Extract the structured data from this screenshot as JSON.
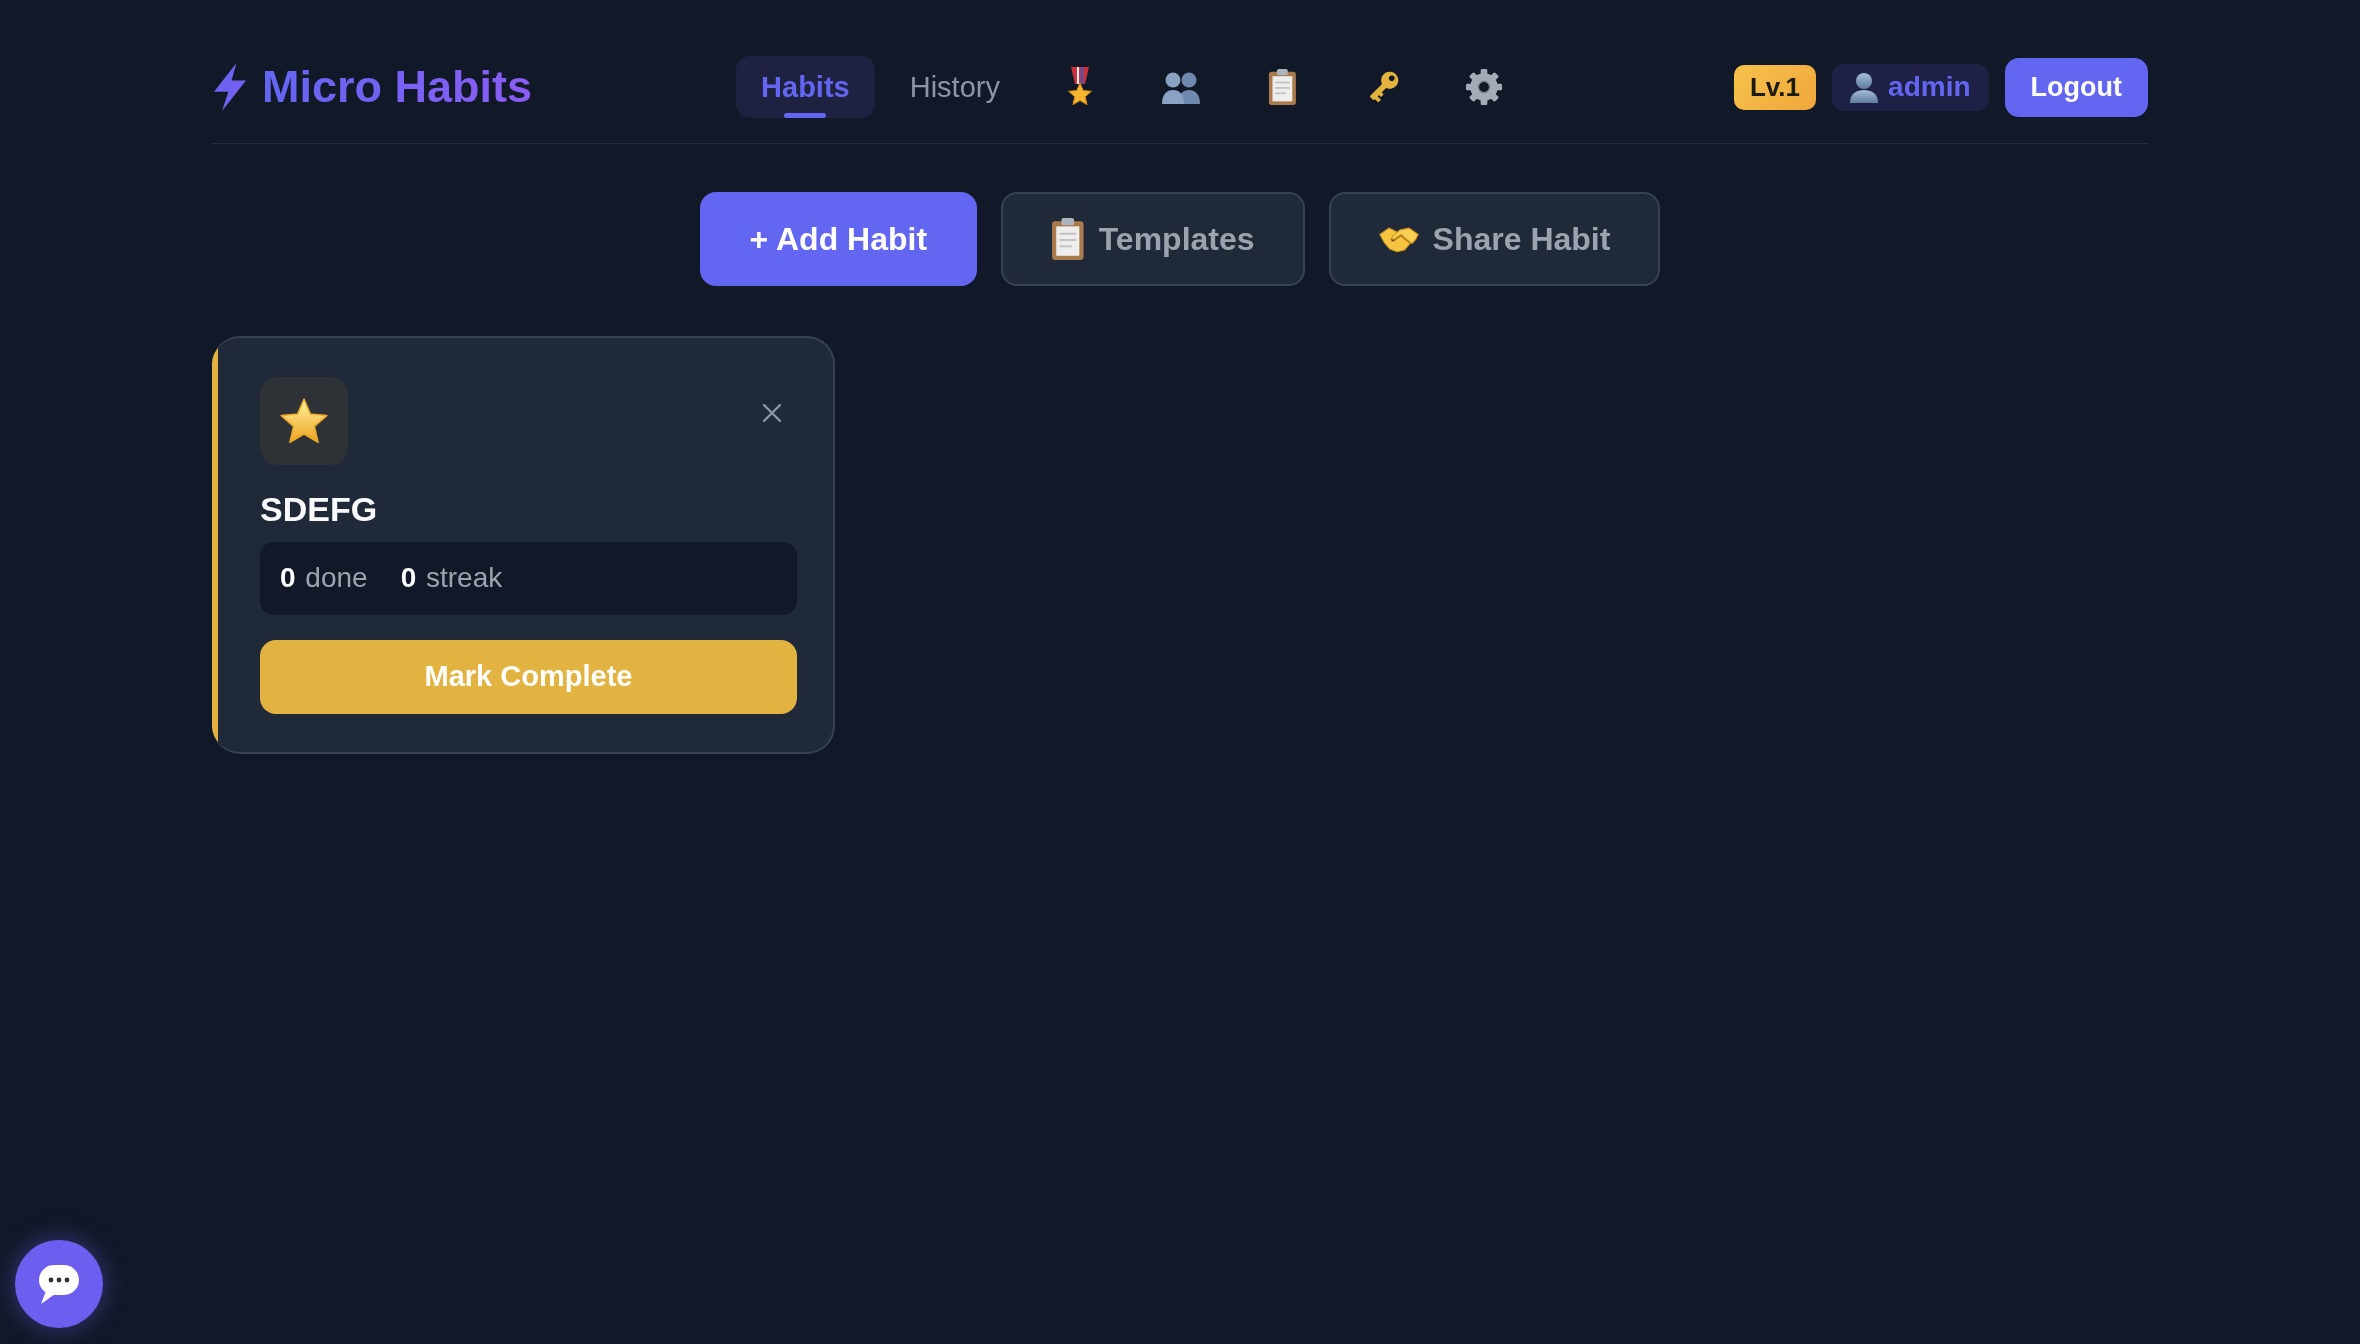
{
  "header": {
    "logo": {
      "text": "Micro Habits"
    },
    "nav_tabs": [
      {
        "kind": "text",
        "label": "Habits",
        "selected": true
      },
      {
        "kind": "text",
        "label": "History",
        "selected": false
      },
      {
        "kind": "icon",
        "selected": false
      },
      {
        "kind": "icon",
        "selected": false
      },
      {
        "kind": "icon",
        "selected": false
      },
      {
        "kind": "icon",
        "selected": false
      },
      {
        "kind": "icon",
        "selected": false
      }
    ],
    "level_badge": "Lv.1",
    "user": {
      "name": "admin"
    },
    "logout_button": "Logout"
  },
  "actions": [
    {
      "kind": "primary",
      "label": "+ Add Habit"
    },
    {
      "kind": "secondary",
      "label": "Templates"
    },
    {
      "kind": "secondary",
      "label": "Share Habit"
    }
  ],
  "habits": [
    {
      "name": "SDEFG",
      "color": "#e3b341",
      "stats": [
        "**0** done",
        "**0** streak"
      ],
      "action": "Mark Complete"
    }
  ]
}
